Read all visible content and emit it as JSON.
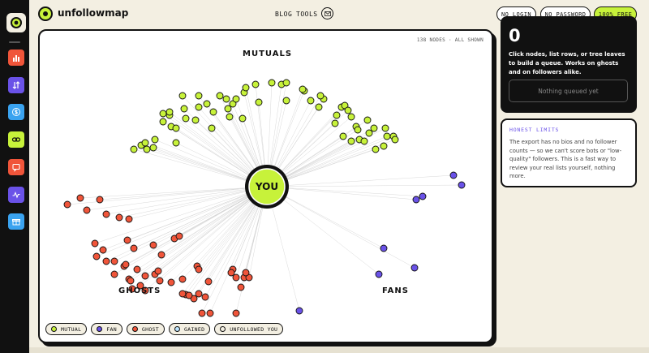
{
  "app": {
    "logo_text": "unfollowmap"
  },
  "nav": {
    "blog": "BLOG",
    "tools": "TOOLS"
  },
  "header_buttons": {
    "no_login": "NO LOGIN",
    "no_password": "NO PASSWORD",
    "free": "100% FREE"
  },
  "rail": {
    "items": [
      {
        "icon": "bar-chart-icon",
        "color": "#f0553a"
      },
      {
        "icon": "sort-arrows-icon",
        "color": "#6a52e8"
      },
      {
        "icon": "dollar-icon",
        "color": "#3aa3f0"
      },
      {
        "icon": "link-icon",
        "color": "#c7f23a"
      },
      {
        "icon": "chat-icon",
        "color": "#f0553a"
      },
      {
        "icon": "activity-icon",
        "color": "#6a52e8"
      },
      {
        "icon": "gift-icon",
        "color": "#3aa3f0"
      }
    ]
  },
  "graph": {
    "meta": "138 NODES · ALL SHOWN",
    "center_label": "YOU",
    "labels": {
      "mutuals": "MUTUALS",
      "ghosts": "GHOSTS",
      "fans": "FANS"
    },
    "colors": {
      "mutual": "#c7f23a",
      "fan": "#6a52e8",
      "ghost": "#f0553a",
      "gained": "#bfe6ff",
      "unfollowed": "#f3efe2"
    },
    "legend": [
      {
        "label": "MUTUAL",
        "color": "#c7f23a"
      },
      {
        "label": "FAN",
        "color": "#6a52e8"
      },
      {
        "label": "GHOST",
        "color": "#f0553a"
      },
      {
        "label": "GAINED",
        "color": "#bfe6ff"
      },
      {
        "label": "UNFOLLOWED YOU",
        "color": "#f3efe2"
      }
    ]
  },
  "queue": {
    "count": "0",
    "description": "Click nodes, list rows, or tree leaves to build a queue. Works on ghosts and on followers alike.",
    "empty_label": "Nothing queued yet"
  },
  "limits": {
    "title": "HONEST LIMITS",
    "text": "The export has no bios and no follower counts — so we can't score bots or \"low-quality\" followers. This is a fast way to review your real lists yourself, nothing more."
  }
}
